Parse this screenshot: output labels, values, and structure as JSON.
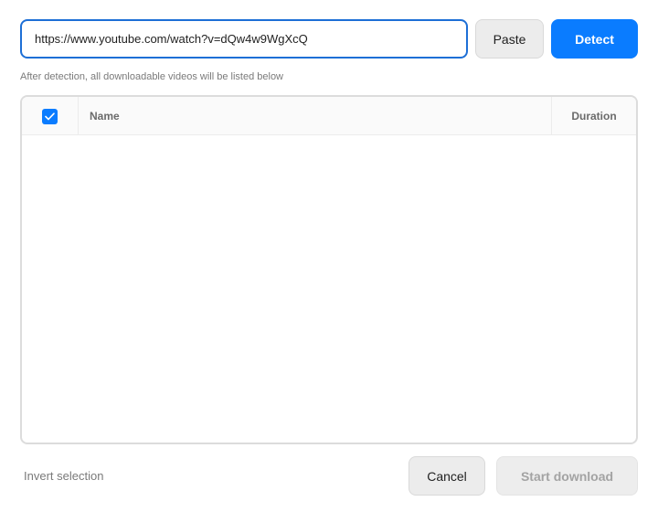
{
  "url_input": {
    "value": "https://www.youtube.com/watch?v=dQw4w9WgXcQ",
    "placeholder": ""
  },
  "buttons": {
    "paste": "Paste",
    "detect": "Detect",
    "cancel": "Cancel",
    "start_download": "Start download"
  },
  "hint": "After detection, all downloadable videos will be listed below",
  "table": {
    "select_all_checked": true,
    "columns": [
      "Name",
      "Duration"
    ],
    "rows": []
  },
  "footer": {
    "invert_selection": "Invert selection"
  },
  "colors": {
    "accent": "#0a7cff",
    "disabled_text": "#a3a3a3"
  }
}
